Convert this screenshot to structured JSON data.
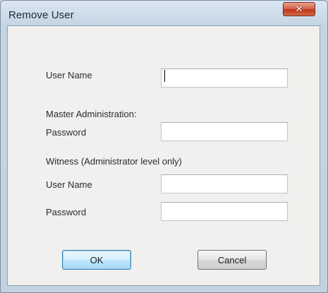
{
  "window": {
    "title": "Remove User",
    "close_icon": "close-icon"
  },
  "form": {
    "user_name_label": "User Name",
    "master_section_label": "Master Administration:",
    "master_password_label": "Password",
    "witness_section_label": "Witness (Administrator level only)",
    "witness_user_name_label": "User Name",
    "witness_password_label": "Password",
    "user_name_value": "",
    "master_password_value": "",
    "witness_user_name_value": "",
    "witness_password_value": ""
  },
  "buttons": {
    "ok_label": "OK",
    "cancel_label": "Cancel"
  }
}
